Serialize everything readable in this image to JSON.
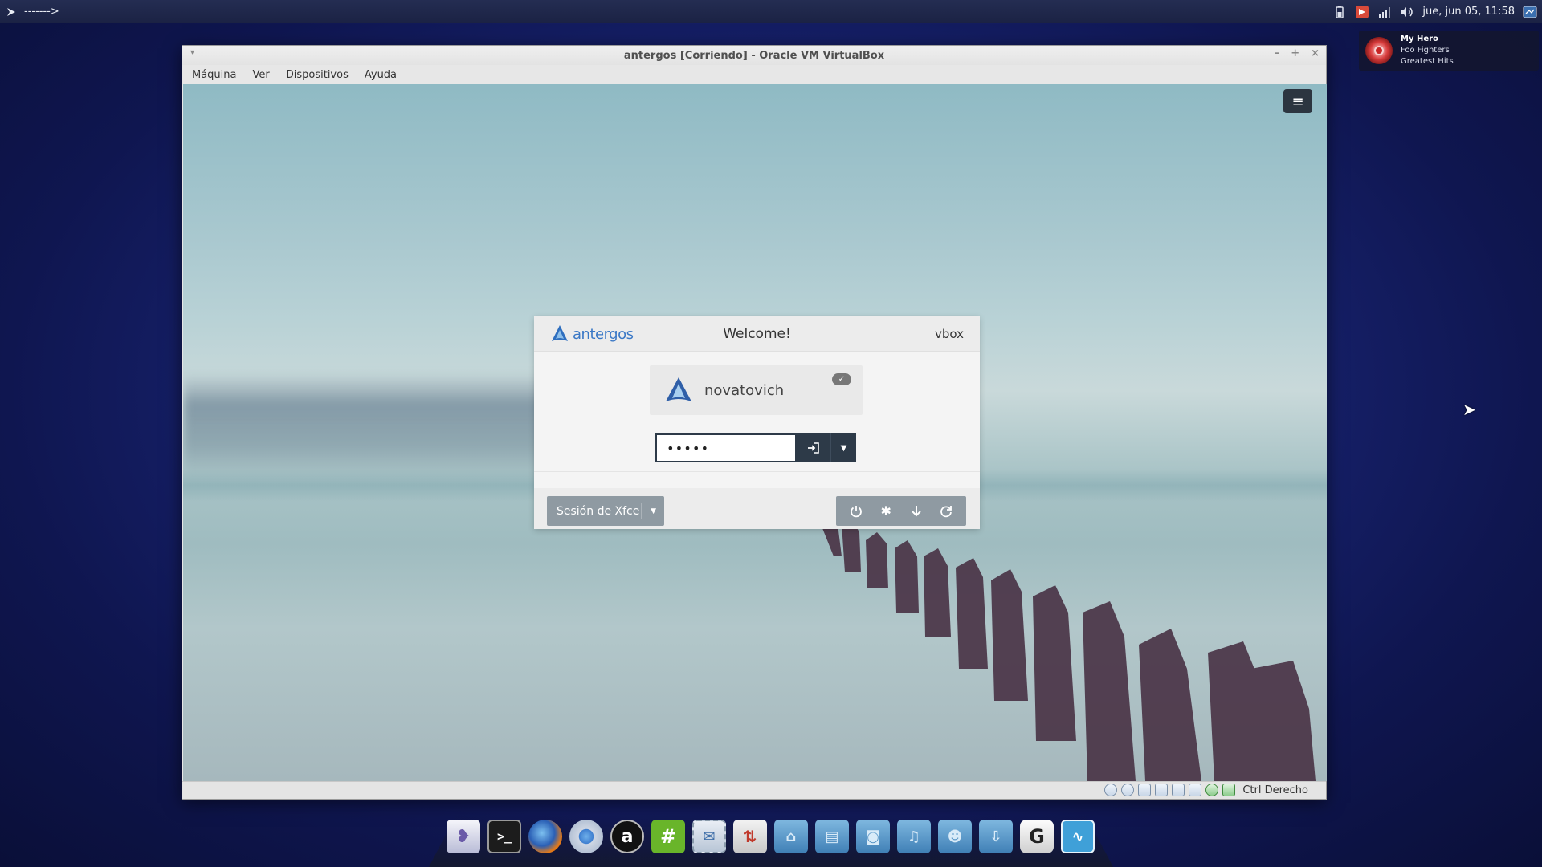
{
  "top_panel": {
    "left_text": "------->",
    "clock": "jue, jun 05, 11:58",
    "tray_icons": [
      "battery-icon",
      "app-indicator-icon",
      "network-signal-icon",
      "volume-icon",
      "display-icon"
    ]
  },
  "notification": {
    "title": "My Hero",
    "artist": "Foo Fighters",
    "album": "Greatest Hits"
  },
  "vbox": {
    "title": "antergos [Corriendo] - Oracle VM VirtualBox",
    "menu": [
      "Máquina",
      "Ver",
      "Dispositivos",
      "Ayuda"
    ],
    "host_key": "Ctrl Derecho"
  },
  "login": {
    "brand": "antergos",
    "welcome": "Welcome!",
    "hostname": "vbox",
    "username": "novatovich",
    "password_mask": "•••••",
    "session": "Sesión de Xfce"
  },
  "dock": {
    "items": [
      "gnome-icon",
      "terminal-icon",
      "firefox-icon",
      "chromium-icon",
      "amazon-icon",
      "hexchat-icon",
      "mail-icon",
      "transmission-icon",
      "home-folder-icon",
      "documents-folder-icon",
      "pictures-folder-icon",
      "music-folder-icon",
      "videos-folder-icon",
      "downloads-folder-icon",
      "grub-icon",
      "system-monitor-icon"
    ]
  }
}
